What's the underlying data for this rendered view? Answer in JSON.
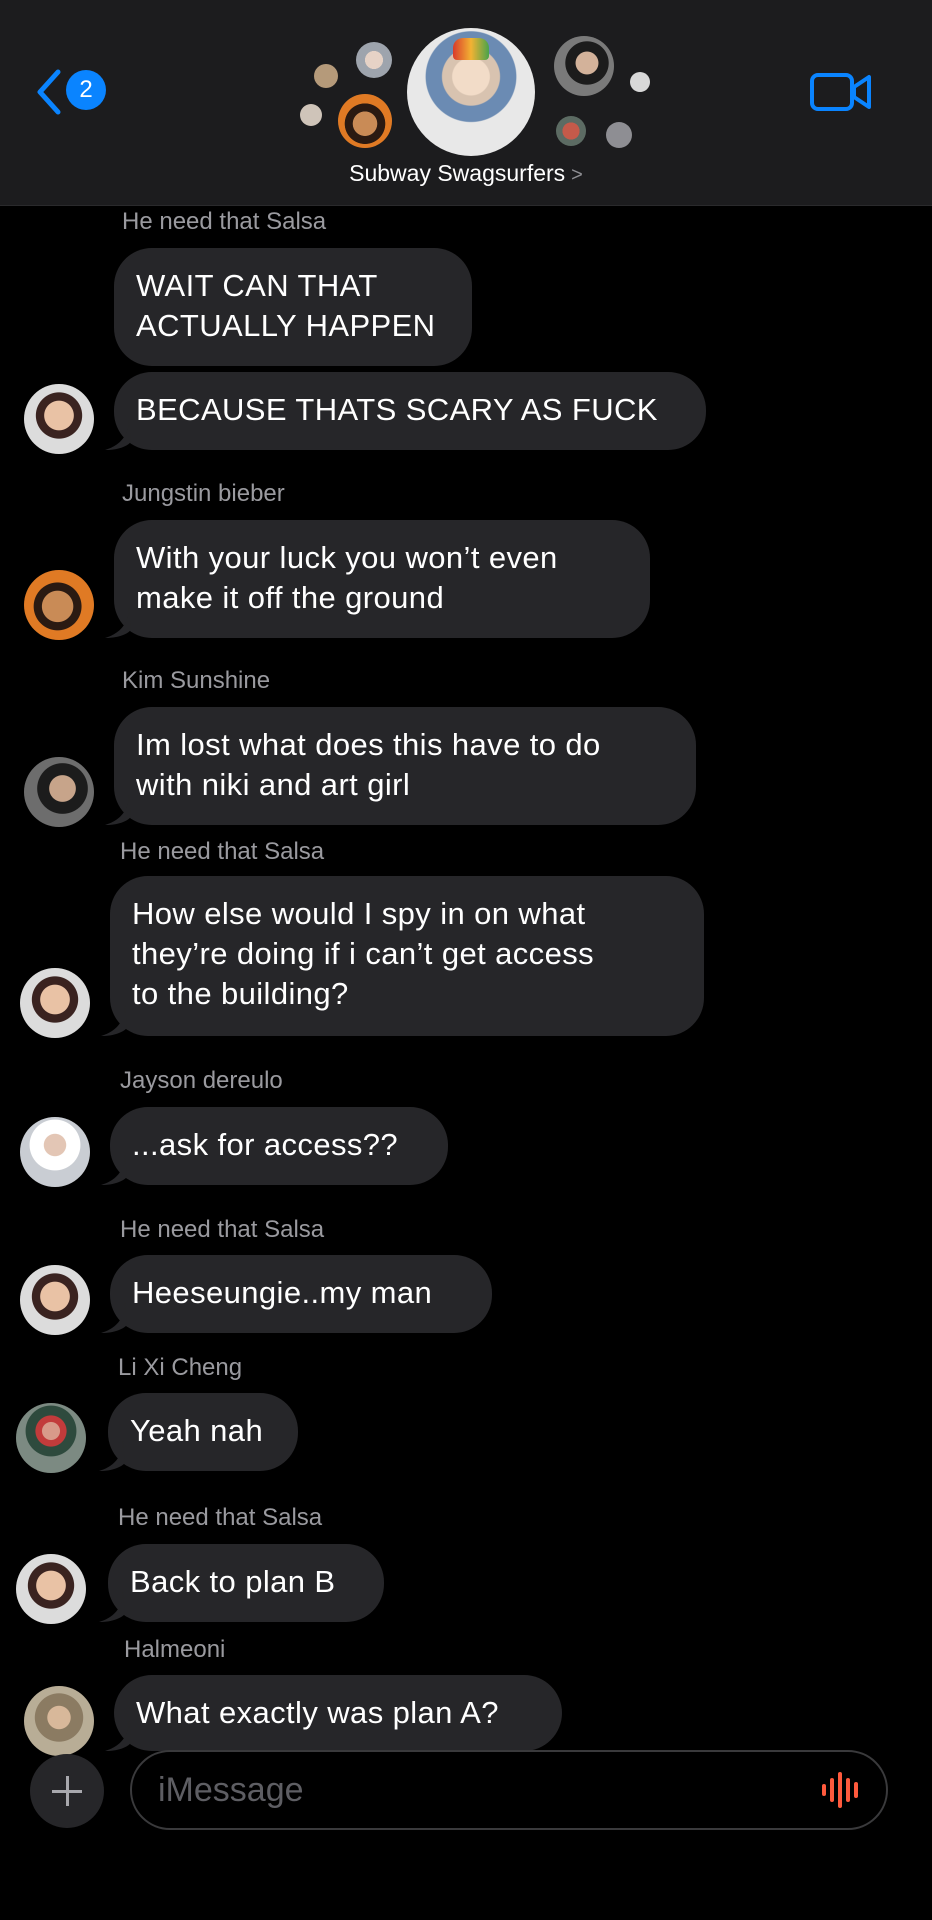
{
  "header": {
    "badge_count": "2",
    "group_name": "Subway Swagsurfers",
    "chevron": ">"
  },
  "messages": [
    {
      "sender": "He need that Salsa",
      "text": "WAIT CAN THAT\nACTUALLY HAPPEN"
    },
    {
      "sender": "",
      "text": "BECAUSE THATS SCARY AS FUCK"
    },
    {
      "sender": "Jungstin bieber",
      "text": "With your luck you won’t even\nmake it off the ground"
    },
    {
      "sender": "Kim Sunshine",
      "text": "Im lost what does this have to do\nwith niki and art girl"
    },
    {
      "sender": "He need that Salsa",
      "text": "How else would I spy in on what\nthey’re doing if i can’t get access\nto the building?"
    },
    {
      "sender": "Jayson dereulo",
      "text": "...ask for access??"
    },
    {
      "sender": "He need that Salsa",
      "text": "Heeseungie..my man"
    },
    {
      "sender": "Li Xi Cheng",
      "text": "Yeah nah"
    },
    {
      "sender": "He need that Salsa",
      "text": "Back to plan B"
    },
    {
      "sender": "Halmeoni",
      "text": "What exactly was plan A?"
    }
  ],
  "composer": {
    "placeholder": "iMessage"
  },
  "colors": {
    "accent": "#0a84ff",
    "bubble": "#262629",
    "header_bg": "#1c1c1e",
    "mic": "#ff5a3d"
  },
  "icons": [
    "back-chevron-icon",
    "video-camera-icon",
    "plus-icon",
    "audio-waveform-icon"
  ]
}
